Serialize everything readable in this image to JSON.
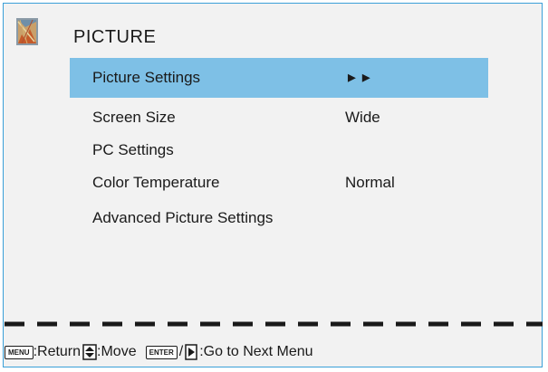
{
  "window": {
    "title": "PICTURE",
    "icon": "picture-menu-icon"
  },
  "menu": {
    "items": [
      {
        "label": "Picture Settings",
        "value": "►►",
        "selected": true
      },
      {
        "label": "Screen Size",
        "value": "Wide",
        "selected": false
      },
      {
        "label": "PC Settings",
        "value": "",
        "selected": false
      },
      {
        "label": "Color Temperature",
        "value": "Normal",
        "selected": false
      },
      {
        "label": "Advanced Picture Settings",
        "value": "",
        "selected": false
      }
    ]
  },
  "footer": {
    "menu_key": "MENU",
    "return_label": ":Return",
    "move_label": ":Move",
    "enter_key": "ENTER",
    "separator": "/",
    "next_label": ":Go to Next Menu"
  },
  "colors": {
    "border": "#3aa0d8",
    "selected_bg": "#7ec0e6",
    "panel_bg": "#f2f2f2",
    "text": "#1a1a1a"
  }
}
